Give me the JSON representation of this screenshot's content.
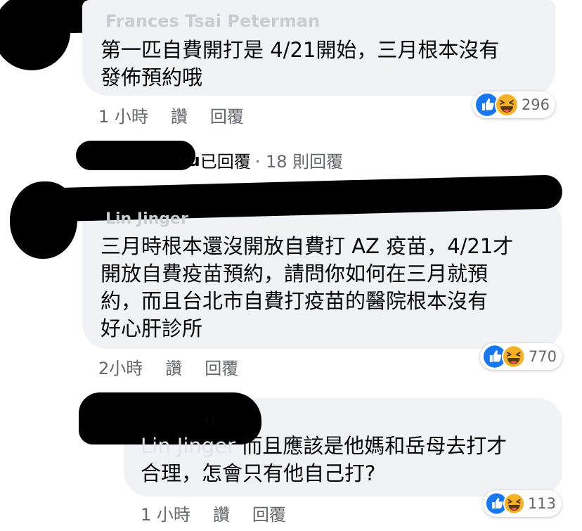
{
  "comments": [
    {
      "author": "Frances Tsai Peterman",
      "text": "第一匹自費開打是 4/21開始，三月根本沒有\n發佈預約哦",
      "time": "1 小時",
      "like_label": "讚",
      "reply_label": "回覆",
      "reaction_count": "296"
    },
    {
      "author": "Lin Jinger",
      "text": "三月時根本還沒開放自費打 AZ 疫苗，4/21才\n開放自費疫苗預約，請問你如何在三月就預\n約，而且台北市自費打疫苗的醫院根本沒有\n好心肝診所",
      "time": "2小時",
      "like_label": "讚",
      "reply_label": "回覆",
      "reaction_count": "770"
    }
  ],
  "replies_summary": {
    "name_suffix": "yu",
    "replied_label": "已回覆",
    "count_label": "· 18 則回覆"
  },
  "reply": {
    "author_suffix": "u",
    "mention": "Lin Jinger",
    "text": " 而且應該是他媽和岳母去打才\n合理，怎會只有他自己打?",
    "time": "1 小時",
    "like_label": "讚",
    "reply_label": "回覆",
    "reaction_count": "113"
  },
  "colors": {
    "bubble": "#f0f2f5",
    "meta_text": "#65676b",
    "like_blue": "#1877f2",
    "haha_yellow": "#f7b125"
  },
  "icons": [
    "like-reaction-icon",
    "haha-reaction-icon"
  ]
}
